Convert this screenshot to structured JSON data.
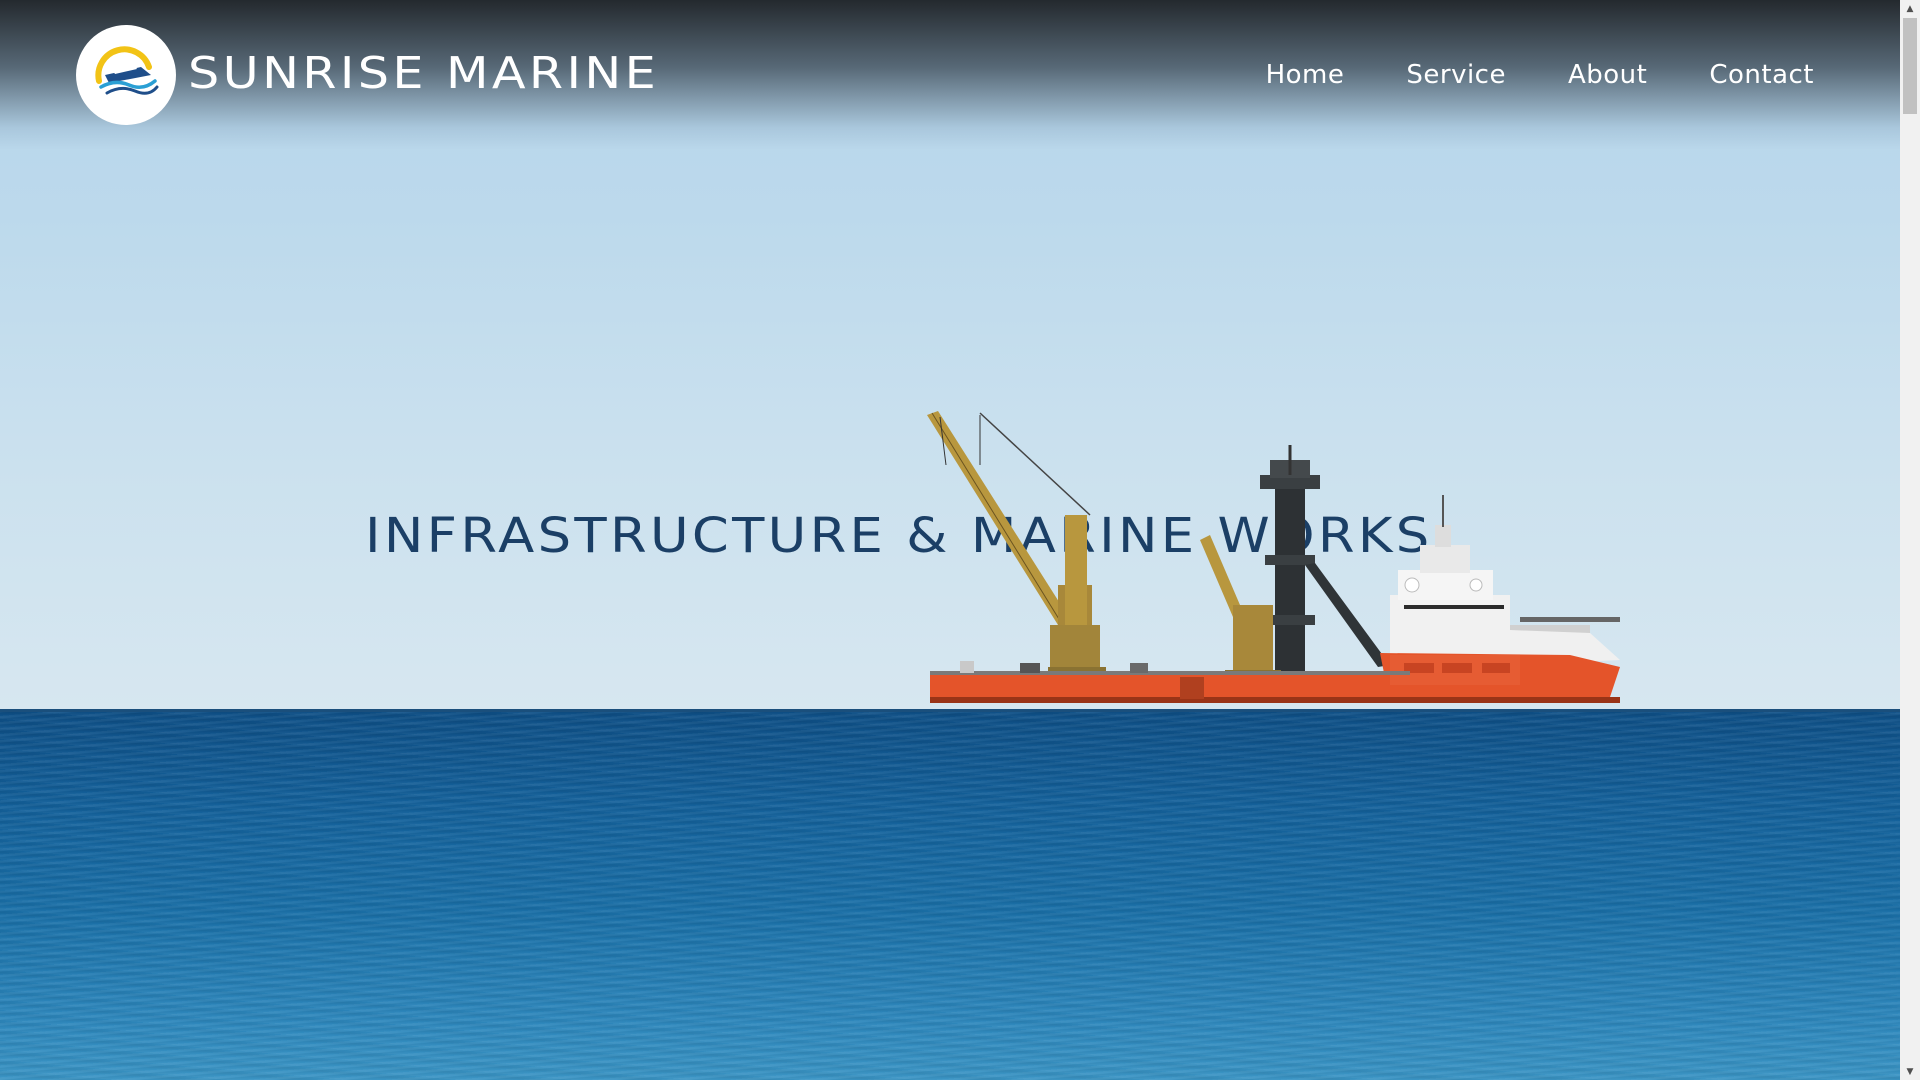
{
  "site": {
    "brand_name": "SUNRISE MARINE",
    "logo_icon": "ship-wave-logo-icon"
  },
  "nav": {
    "items": [
      {
        "label": "Home"
      },
      {
        "label": "Service"
      },
      {
        "label": "About"
      },
      {
        "label": "Contact"
      }
    ]
  },
  "hero": {
    "headline": "INFRASTRUCTURE & MARINE WORKS",
    "image": "offshore-construction-vessel"
  },
  "colors": {
    "sky": "#bcd9ec",
    "sea": "#13609a",
    "headline": "#1b3f66",
    "nav_text": "#ffffff",
    "vessel_hull": "#e4542a"
  },
  "scrollbar": {
    "up_icon": "arrow-up-icon",
    "down_icon": "arrow-down-icon"
  }
}
